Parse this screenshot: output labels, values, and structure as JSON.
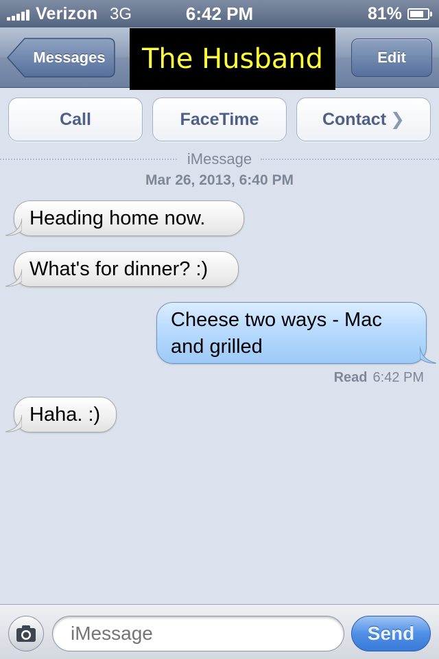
{
  "status_bar": {
    "carrier": "Verizon",
    "network": "3G",
    "time": "6:42 PM",
    "battery_percent": "81%",
    "battery_level": 0.81,
    "signal_bars": 5
  },
  "nav": {
    "back_label": "Messages",
    "title": "The Husband",
    "edit_label": "Edit",
    "title_color": "#ffff3a"
  },
  "actions": {
    "call_label": "Call",
    "facetime_label": "FaceTime",
    "contact_label": "Contact",
    "contact_icon": "chevron-right-icon"
  },
  "conversation": {
    "service": "iMessage",
    "timestamp": "Mar 26, 2013, 6:40 PM",
    "messages": [
      {
        "direction": "incoming",
        "text": "Heading home now."
      },
      {
        "direction": "incoming",
        "text": "What's for dinner? :)"
      },
      {
        "direction": "outgoing",
        "text": "Cheese two ways - Mac and grilled"
      },
      {
        "direction": "incoming",
        "text": "Haha. :)"
      }
    ],
    "read_receipt": {
      "label": "Read",
      "time": "6:42 PM"
    }
  },
  "composer": {
    "camera_icon": "camera-icon",
    "placeholder": "iMessage",
    "send_label": "Send",
    "send_color": "#3a7ad9"
  }
}
